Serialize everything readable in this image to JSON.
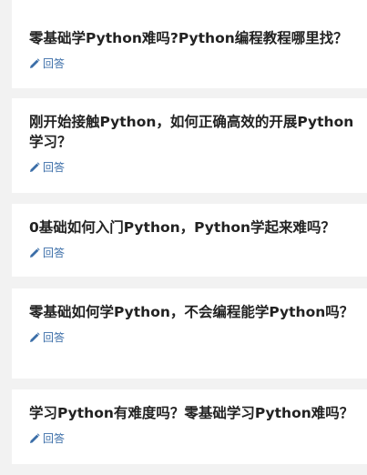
{
  "questions": [
    {
      "title": "零基础学Python难吗?Python编程教程哪里找？",
      "answer_label": "回答",
      "answer_icon": "pencil-icon"
    },
    {
      "title": "刚开始接触Python，如何正确高效的开展Python学习？",
      "answer_label": "回答",
      "answer_icon": "pencil-icon"
    },
    {
      "title": "0基础如何入门Python，Python学起来难吗？",
      "answer_label": "回答",
      "answer_icon": "pencil-icon"
    },
    {
      "title": "零基础如何学Python，不会编程能学Python吗？",
      "answer_label": "回答",
      "answer_icon": "pencil-icon"
    },
    {
      "title": "学习Python有难度吗？零基础学习Python难吗？",
      "answer_label": "回答",
      "answer_icon": "pencil-icon"
    }
  ],
  "colors": {
    "background": "#f2f2f2",
    "card": "#ffffff",
    "title": "#222222",
    "answer_link": "#3b6ea8"
  }
}
